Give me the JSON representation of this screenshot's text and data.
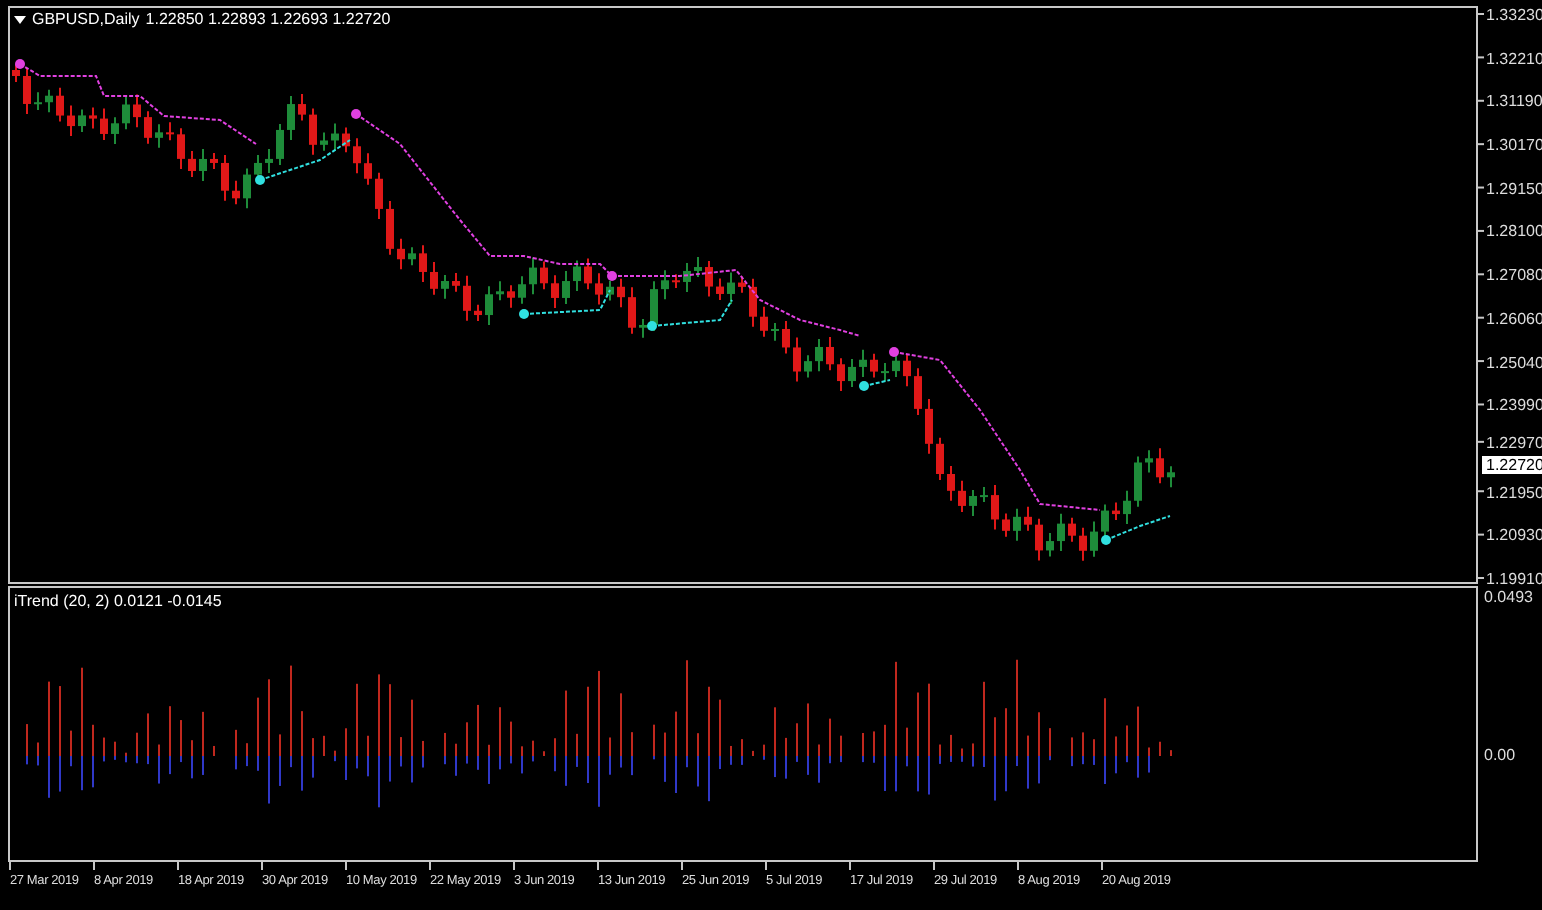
{
  "chart": {
    "symbol": "GBPUSD,Daily",
    "ohlc": "1.22850 1.22893 1.22693 1.22720",
    "price_axis": [
      "1.33230",
      "1.32210",
      "1.31190",
      "1.30170",
      "1.29150",
      "1.28100",
      "1.27080",
      "1.26060",
      "1.25040",
      "1.23990",
      "1.22970",
      "1.21950",
      "1.20930",
      "1.19910"
    ],
    "current_price": "1.22720"
  },
  "indicator": {
    "label": "iTrend (20, 2) 0.0121 -0.0145",
    "axis": [
      "0.0493",
      "0.00"
    ]
  },
  "time_axis": [
    "27 Mar 2019",
    "8 Apr 2019",
    "18 Apr 2019",
    "30 Apr 2019",
    "10 May 2019",
    "22 May 2019",
    "3 Jun 2019",
    "13 Jun 2019",
    "25 Jun 2019",
    "5 Jul 2019",
    "17 Jul 2019",
    "29 Jul 2019",
    "8 Aug 2019",
    "20 Aug 2019"
  ]
}
